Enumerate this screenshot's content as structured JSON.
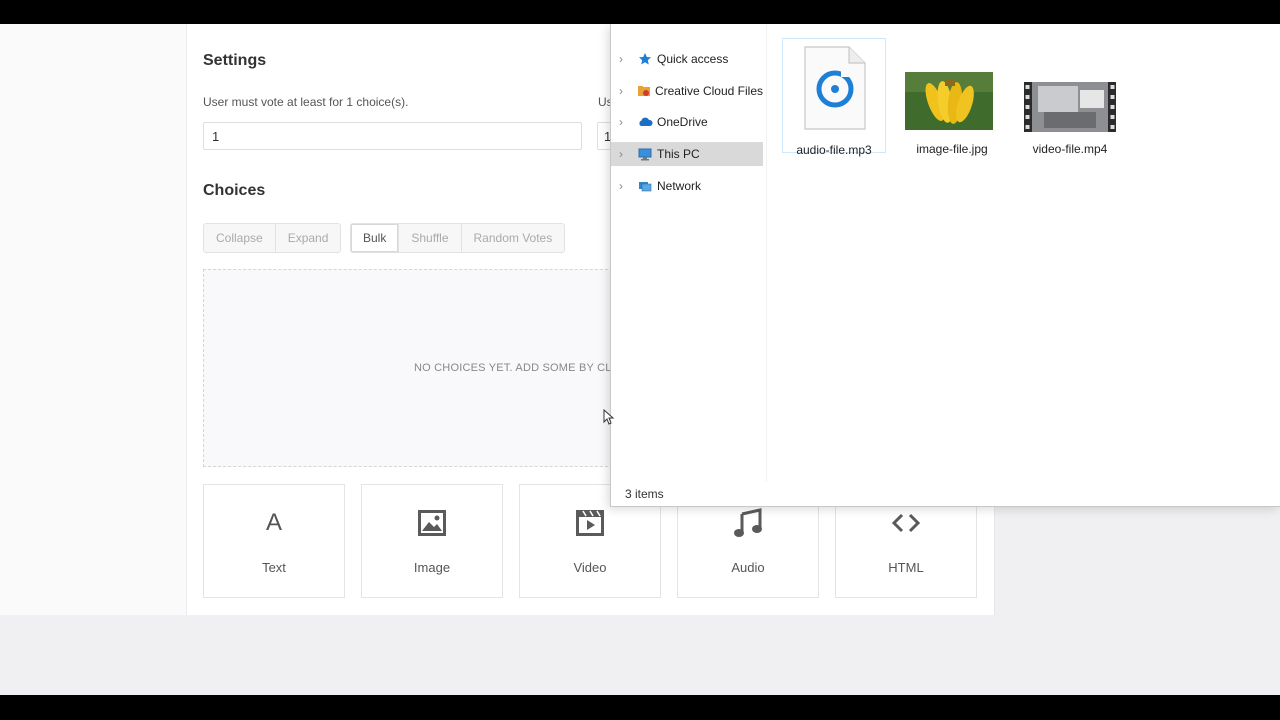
{
  "settings": {
    "title": "Settings",
    "min_label": "User must vote at least for 1 choice(s).",
    "max_label_partial": "Us",
    "min_value": "1",
    "max_value": "1"
  },
  "choices": {
    "title": "Choices",
    "buttons_group1": [
      "Collapse",
      "Expand"
    ],
    "buttons_group2": [
      "Bulk",
      "Shuffle",
      "Random Votes"
    ],
    "empty_text": "NO CHOICES YET. ADD SOME BY CLIC"
  },
  "tiles": [
    {
      "label": "Text",
      "icon": "text-icon"
    },
    {
      "label": "Image",
      "icon": "image-icon"
    },
    {
      "label": "Video",
      "icon": "video-icon"
    },
    {
      "label": "Audio",
      "icon": "audio-icon"
    },
    {
      "label": "HTML",
      "icon": "html-icon"
    }
  ],
  "explorer": {
    "nav": [
      {
        "label": "Quick access",
        "icon": "star-icon",
        "color": "#1e7fd6"
      },
      {
        "label": "Creative Cloud Files",
        "icon": "creative-cloud-icon",
        "color": "#e8a23a"
      },
      {
        "label": "OneDrive",
        "icon": "cloud-icon",
        "color": "#1c6fc4"
      },
      {
        "label": "This PC",
        "icon": "computer-icon",
        "color": "#3a8fd8"
      },
      {
        "label": "Network",
        "icon": "network-icon",
        "color": "#2f86c9"
      }
    ],
    "selected_nav": "This PC",
    "files": [
      {
        "name": "audio-file.mp3",
        "icon": "audio-file-icon"
      },
      {
        "name": "image-file.jpg",
        "icon": "image-thumbnail"
      },
      {
        "name": "video-file.mp4",
        "icon": "video-thumbnail"
      }
    ],
    "status": "3 items"
  },
  "colors": {
    "accent_blue": "#1e7fd6",
    "selection_gray": "#d9d9d9"
  }
}
